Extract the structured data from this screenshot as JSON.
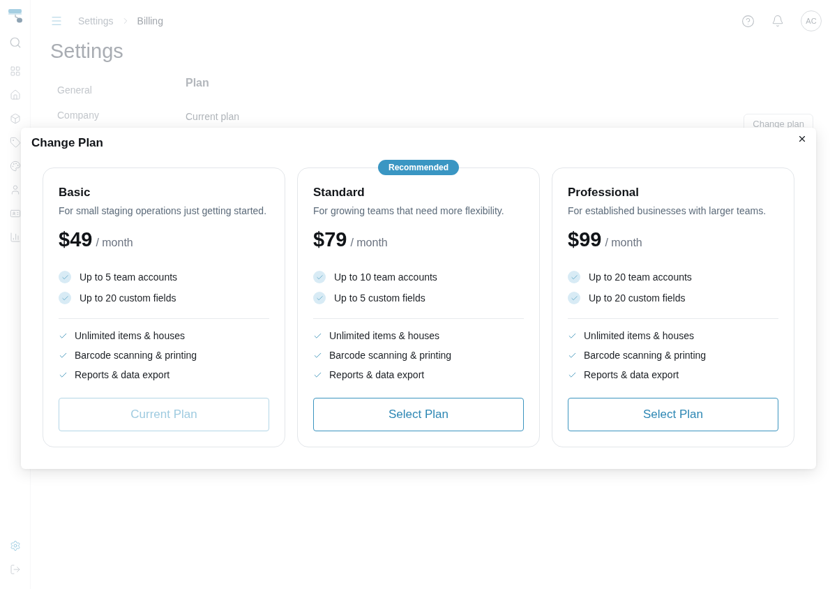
{
  "sidebar": {
    "nav": [
      {
        "selected": false
      },
      {
        "selected": false
      },
      {
        "selected": false
      },
      {
        "selected": false
      },
      {
        "selected": false
      },
      {
        "selected": false
      },
      {
        "selected": false
      },
      {
        "selected": false
      }
    ],
    "footer": [
      {
        "selected": true
      },
      {
        "selected": false
      }
    ]
  },
  "header": {
    "breadcrumbs": [
      {
        "label": "Settings",
        "current": false
      },
      {
        "label": "Billing",
        "current": true
      }
    ],
    "avatar": "AC"
  },
  "page": {
    "title": "Settings",
    "nav": [
      {
        "label": "General"
      },
      {
        "label": "Company"
      }
    ],
    "section": {
      "title": "Plan",
      "label": "Current plan",
      "button": "Change plan"
    }
  },
  "modal": {
    "title": "Change Plan",
    "plans": [
      {
        "name": "Basic",
        "description": "For small staging operations just getting started.",
        "price": "$49",
        "period": "/ month",
        "highlights": [
          "Up to 5 team accounts",
          "Up to 20 custom fields"
        ],
        "features": [
          "Unlimited items & houses",
          "Barcode scanning & printing",
          "Reports & data export"
        ],
        "button": {
          "label": "Current Plan",
          "disabled": true
        }
      },
      {
        "name": "Standard",
        "badge": "Recommended",
        "description": "For growing teams that need more flexibility.",
        "price": "$79",
        "period": "/ month",
        "highlights": [
          "Up to 10 team accounts",
          "Up to 5 custom fields"
        ],
        "features": [
          "Unlimited items & houses",
          "Barcode scanning & printing",
          "Reports & data export"
        ],
        "button": {
          "label": "Select Plan",
          "disabled": false
        }
      },
      {
        "name": "Professional",
        "description": "For established businesses with larger teams.",
        "price": "$99",
        "period": "/ month",
        "highlights": [
          "Up to 20 team accounts",
          "Up to 20 custom fields"
        ],
        "features": [
          "Unlimited items & houses",
          "Barcode scanning & printing",
          "Reports & data export"
        ],
        "button": {
          "label": "Select Plan",
          "disabled": false
        }
      }
    ]
  }
}
